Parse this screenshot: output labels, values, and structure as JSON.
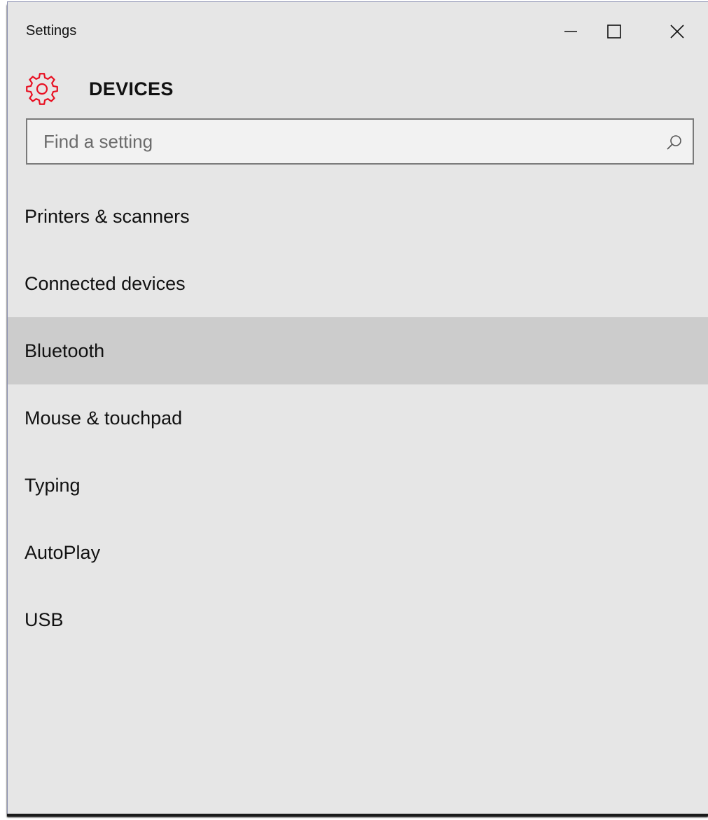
{
  "window": {
    "title": "Settings",
    "controls": {
      "minimize": "minimize-icon",
      "maximize": "maximize-icon",
      "close": "close-icon"
    }
  },
  "header": {
    "icon": "gear-icon",
    "icon_color": "#e81123",
    "title": "DEVICES"
  },
  "search": {
    "value": "",
    "placeholder": "Find a setting",
    "icon": "search-icon"
  },
  "nav": {
    "selected_index": 2,
    "selected_bg": "#cccccc",
    "items": [
      {
        "label": "Printers & scanners"
      },
      {
        "label": "Connected devices"
      },
      {
        "label": "Bluetooth"
      },
      {
        "label": "Mouse & touchpad"
      },
      {
        "label": "Typing"
      },
      {
        "label": "AutoPlay"
      },
      {
        "label": "USB"
      }
    ]
  }
}
